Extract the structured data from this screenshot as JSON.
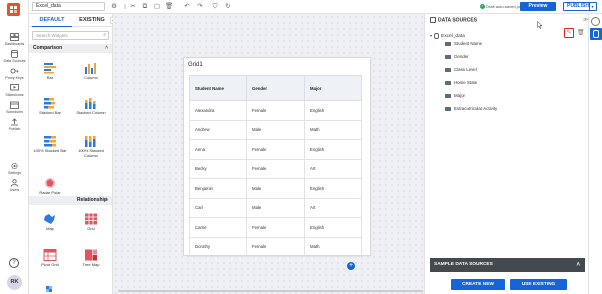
{
  "topbar": {
    "dashboard_name": "Excel_data",
    "status_text": "Draft auto-saved just now",
    "preview_label": "Preview",
    "publish_label": "PUBLISH"
  },
  "nav": {
    "items": [
      {
        "label": "Dashboards"
      },
      {
        "label": "Data Sources"
      },
      {
        "label": "Proxy Keys"
      },
      {
        "label": "Slideshows"
      },
      {
        "label": "Schedules"
      },
      {
        "label": "Publish"
      },
      {
        "label": "Settings"
      },
      {
        "label": "Users"
      }
    ],
    "help": "?",
    "avatar": "RK"
  },
  "widget_panel": {
    "tab_default": "DEFAULT",
    "tab_existing": "EXISTING",
    "search_placeholder": "Search Widgets",
    "category_comparison": "Comparison",
    "category_relationship": "Relationship",
    "widgets": {
      "bar": "Bar",
      "column": "Column",
      "stacked_bar": "Stacked Bar",
      "stacked_column": "Stacked Column",
      "stacked_bar_100": "100% Stacked Bar",
      "stacked_column_100": "100% Stacked Column",
      "radar_polar": "Radar Polar",
      "map": "Map",
      "grid": "Grid",
      "pivot_grid": "Pivot Grid",
      "tree_map": "Tree Map"
    }
  },
  "canvas": {
    "widget_title": "Grid1",
    "grid": {
      "headers": [
        "Student Name",
        "Gender",
        "Major"
      ],
      "rows": [
        [
          "Alexandra",
          "Female",
          "English"
        ],
        [
          "Andrew",
          "Male",
          "Math"
        ],
        [
          "Anna",
          "Female",
          "English"
        ],
        [
          "Becky",
          "Female",
          "Art"
        ],
        [
          "Benjamin",
          "Male",
          "English"
        ],
        [
          "Carl",
          "Male",
          "Art"
        ],
        [
          "Carrie",
          "Female",
          "English"
        ],
        [
          "Dorothy",
          "Female",
          "Math"
        ]
      ]
    },
    "add_label": "+"
  },
  "data_sources": {
    "header": "DATA SOURCES",
    "source_name": "Excel_data",
    "fields": [
      "Student Name",
      "Gender",
      "Class Level",
      "Home State",
      "Major",
      "Extracurricular Activity"
    ],
    "sample_header": "SAMPLE DATA SOURCES",
    "create_new": "CREATE NEW",
    "use_existing": "USE EXISTING"
  },
  "colors": {
    "accent": "#1565d8",
    "brand": "#e8521d",
    "highlight": "#e02323",
    "success": "#2aa35a"
  }
}
